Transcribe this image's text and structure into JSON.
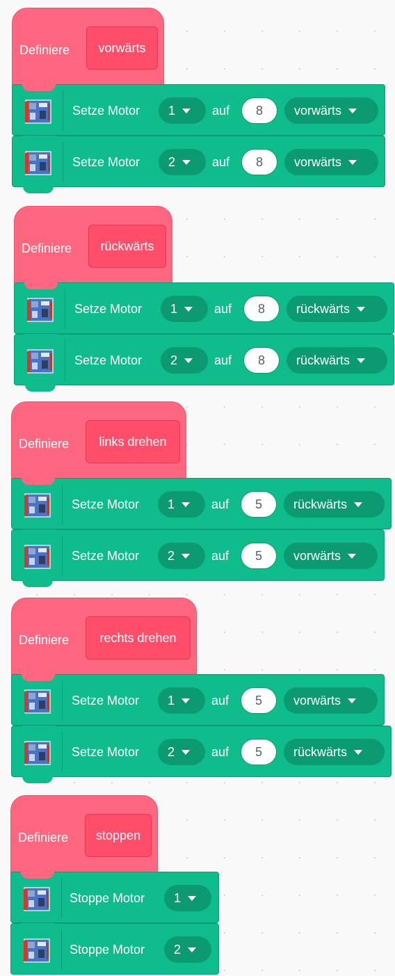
{
  "colors": {
    "define_block": "#ff6680",
    "prototype": "#ff4d6a",
    "motor_block": "#0fbd8c",
    "dropdown": "#0b9a72",
    "canvas": "#f9f9f9"
  },
  "extension_icon": "robot-board-icon",
  "scripts": [
    {
      "define_label": "Definiere",
      "name": "vorwärts",
      "blocks": [
        {
          "label": "Setze Motor",
          "motor": "1",
          "auf": "auf",
          "speed": "8",
          "direction": "vorwärts"
        },
        {
          "label": "Setze Motor",
          "motor": "2",
          "auf": "auf",
          "speed": "8",
          "direction": "vorwärts"
        }
      ]
    },
    {
      "define_label": "Definiere",
      "name": "rückwärts",
      "blocks": [
        {
          "label": "Setze Motor",
          "motor": "1",
          "auf": "auf",
          "speed": "8",
          "direction": "rückwärts"
        },
        {
          "label": "Setze Motor",
          "motor": "2",
          "auf": "auf",
          "speed": "8",
          "direction": "rückwärts"
        }
      ]
    },
    {
      "define_label": "Definiere",
      "name": "links drehen",
      "blocks": [
        {
          "label": "Setze Motor",
          "motor": "1",
          "auf": "auf",
          "speed": "5",
          "direction": "rückwärts"
        },
        {
          "label": "Setze Motor",
          "motor": "2",
          "auf": "auf",
          "speed": "5",
          "direction": "vorwärts"
        }
      ]
    },
    {
      "define_label": "Definiere",
      "name": "rechts drehen",
      "blocks": [
        {
          "label": "Setze Motor",
          "motor": "1",
          "auf": "auf",
          "speed": "5",
          "direction": "vorwärts"
        },
        {
          "label": "Setze Motor",
          "motor": "2",
          "auf": "auf",
          "speed": "5",
          "direction": "rückwärts"
        }
      ]
    },
    {
      "define_label": "Definiere",
      "name": "stoppen",
      "blocks": [
        {
          "label": "Stoppe Motor",
          "motor": "1"
        },
        {
          "label": "Stoppe Motor",
          "motor": "2"
        }
      ]
    }
  ]
}
